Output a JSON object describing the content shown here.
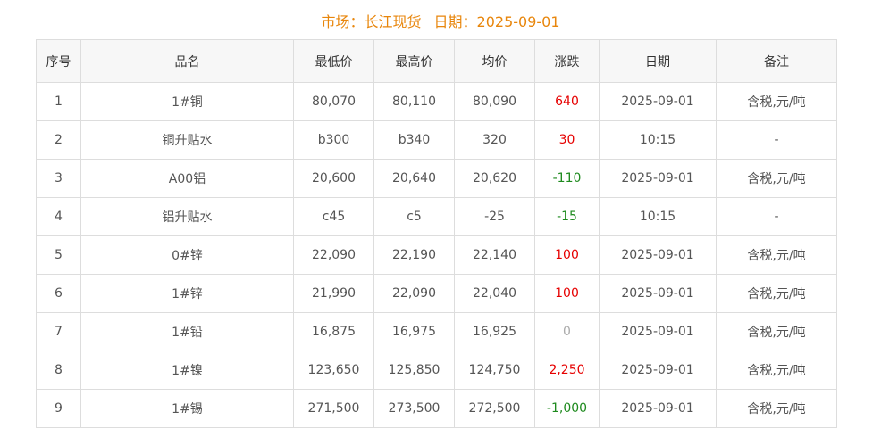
{
  "header": {
    "market_label": "市场：",
    "market_value": "长江现货",
    "date_label": "日期：",
    "date_value": "2025-09-01"
  },
  "table": {
    "columns": [
      "序号",
      "品名",
      "最低价",
      "最高价",
      "均价",
      "涨跌",
      "日期",
      "备注"
    ],
    "rows": [
      {
        "no": "1",
        "name": "1#铜",
        "low": "80,070",
        "high": "80,110",
        "avg": "80,090",
        "change": "640",
        "trend": "up",
        "date": "2025-09-01",
        "note": "含税,元/吨"
      },
      {
        "no": "2",
        "name": "铜升贴水",
        "low": "b300",
        "high": "b340",
        "avg": "320",
        "change": "30",
        "trend": "up",
        "date": "10:15",
        "note": "-"
      },
      {
        "no": "3",
        "name": "A00铝",
        "low": "20,600",
        "high": "20,640",
        "avg": "20,620",
        "change": "-110",
        "trend": "down",
        "date": "2025-09-01",
        "note": "含税,元/吨"
      },
      {
        "no": "4",
        "name": "铝升贴水",
        "low": "c45",
        "high": "c5",
        "avg": "-25",
        "change": "-15",
        "trend": "down",
        "date": "10:15",
        "note": "-"
      },
      {
        "no": "5",
        "name": "0#锌",
        "low": "22,090",
        "high": "22,190",
        "avg": "22,140",
        "change": "100",
        "trend": "up",
        "date": "2025-09-01",
        "note": "含税,元/吨"
      },
      {
        "no": "6",
        "name": "1#锌",
        "low": "21,990",
        "high": "22,090",
        "avg": "22,040",
        "change": "100",
        "trend": "up",
        "date": "2025-09-01",
        "note": "含税,元/吨"
      },
      {
        "no": "7",
        "name": "1#铅",
        "low": "16,875",
        "high": "16,975",
        "avg": "16,925",
        "change": "0",
        "trend": "flat",
        "date": "2025-09-01",
        "note": "含税,元/吨"
      },
      {
        "no": "8",
        "name": "1#镍",
        "low": "123,650",
        "high": "125,850",
        "avg": "124,750",
        "change": "2,250",
        "trend": "up",
        "date": "2025-09-01",
        "note": "含税,元/吨"
      },
      {
        "no": "9",
        "name": "1#锡",
        "low": "271,500",
        "high": "273,500",
        "avg": "272,500",
        "change": "-1,000",
        "trend": "down",
        "date": "2025-09-01",
        "note": "含税,元/吨"
      }
    ]
  },
  "colors": {
    "title": "#e8860c",
    "up": "#e60000",
    "down": "#1e8a1e",
    "flat": "#aaaaaa",
    "header_bg": "#f7f7f7",
    "border": "#dddddd"
  }
}
